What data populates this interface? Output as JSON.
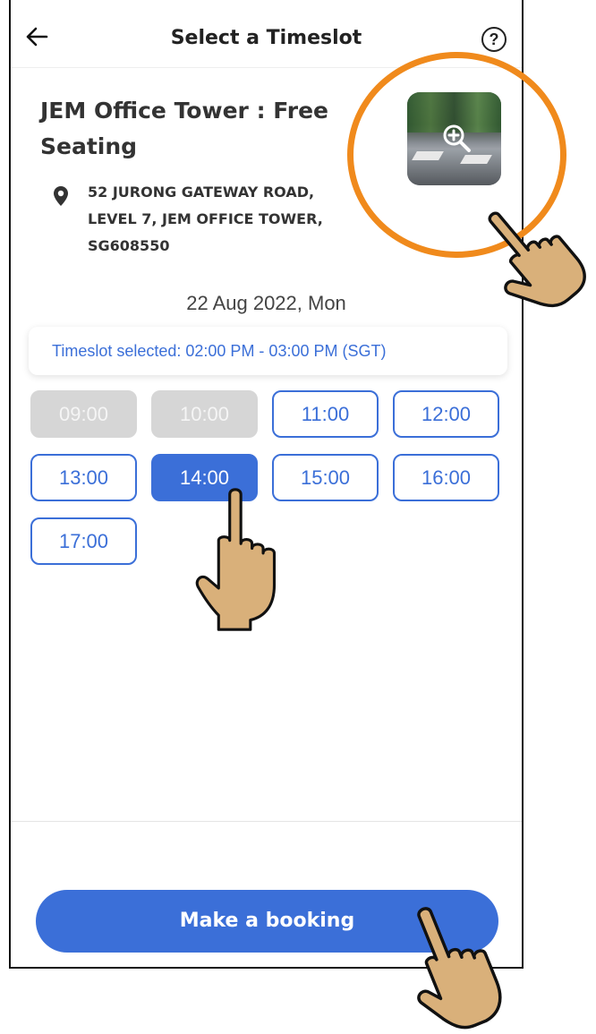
{
  "header": {
    "back_icon": "arrow-left-icon",
    "title": "Select a Timeslot",
    "help_icon": "question-circle-icon",
    "help_glyph": "?"
  },
  "venue": {
    "title": "JEM Office Tower : Free Seating",
    "address": "52 JURONG GATEWAY ROAD, LEVEL 7, JEM OFFICE TOWER, SG608550",
    "photo_icon": "zoom-in-icon",
    "pin_icon": "location-pin-icon"
  },
  "schedule": {
    "date": "22 Aug 2022, Mon",
    "selected_text": "Timeslot selected: 02:00 PM - 03:00 PM (SGT)",
    "slots": [
      {
        "label": "09:00",
        "state": "disabled"
      },
      {
        "label": "10:00",
        "state": "disabled"
      },
      {
        "label": "11:00",
        "state": "available"
      },
      {
        "label": "12:00",
        "state": "available"
      },
      {
        "label": "13:00",
        "state": "available"
      },
      {
        "label": "14:00",
        "state": "selected"
      },
      {
        "label": "15:00",
        "state": "available"
      },
      {
        "label": "16:00",
        "state": "available"
      },
      {
        "label": "17:00",
        "state": "available"
      }
    ]
  },
  "footer": {
    "book_label": "Make a booking"
  },
  "colors": {
    "accent": "#3b6fd8",
    "disabled": "#d6d6d6",
    "highlight": "#f08a1c",
    "hand_fill": "#d9b07a"
  },
  "overlays": {
    "hand_icon": "pointing-hand-icon",
    "highlight": "highlight-circle"
  }
}
